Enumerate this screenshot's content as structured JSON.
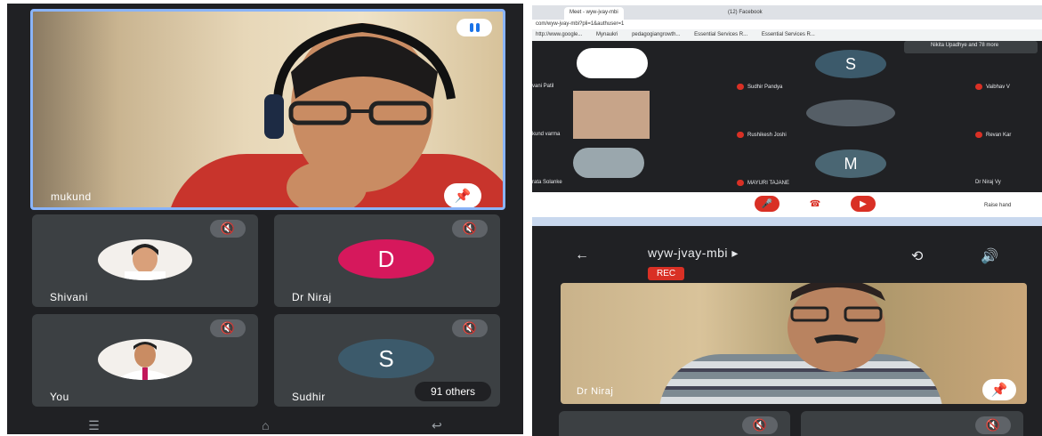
{
  "left_phone": {
    "speaker": {
      "name": "mukund"
    },
    "tiles": [
      {
        "name": "Shivani"
      },
      {
        "name": "Dr Niraj",
        "initial": "D",
        "color": "#d6185c"
      },
      {
        "name": "You"
      },
      {
        "name": "Sudhir",
        "initial": "S",
        "color": "#3c5a6b",
        "chip": "91 others"
      }
    ]
  },
  "laptop": {
    "tabs": [
      "Meet - wyw-jvay-mbi",
      "(12) Facebook"
    ],
    "url": "com/wyw-jvay-mbi?pli=1&authuser=1",
    "bookmarks": [
      "http://www.google...",
      "Mynaukri",
      "pedagogiangrowth...",
      "Essential Services R...",
      "Essential Services R..."
    ],
    "participants_header": "Nikita Upadhye and 78 more",
    "grid": [
      {
        "name": "vani Patil"
      },
      {
        "name": "Sudhir Pandya",
        "initial": "S"
      },
      {
        "name": "Vaibhav V"
      },
      {
        "name": "kund varma"
      },
      {
        "name": "Rushikesh Joshi"
      },
      {
        "name": "Revan Kar"
      },
      {
        "name": "rata Solanke"
      },
      {
        "name": "MAYURI TAJANE",
        "initial": "M"
      },
      {
        "name": "Dr Niraj Vy"
      }
    ],
    "raise_hand": "Raise hand"
  },
  "right_phone": {
    "meeting_title": "wyw-jvay-mbi",
    "rec_label": "REC",
    "speaker_name": "Dr Niraj"
  }
}
